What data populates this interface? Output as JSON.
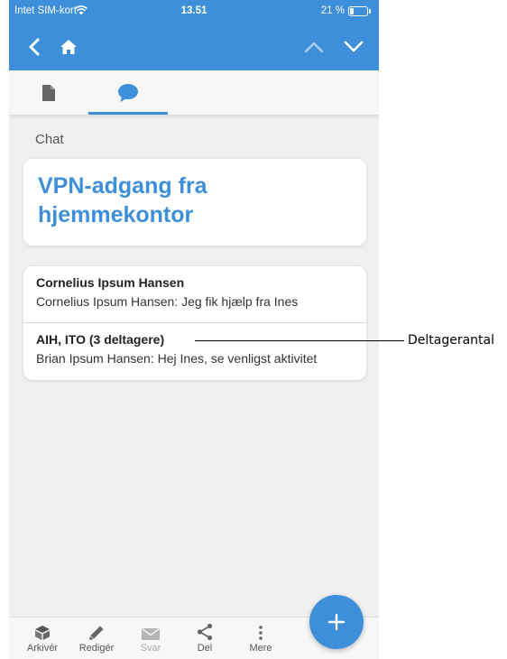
{
  "status_bar": {
    "carrier": "Intet SIM-kort",
    "time": "13.51",
    "battery": "21 %"
  },
  "nav": {
    "back_icon": "chevron-left-icon",
    "home_icon": "home-icon",
    "up_icon": "chevron-up-icon",
    "down_icon": "chevron-down-icon"
  },
  "tabs": [
    {
      "icon": "document-icon",
      "selected": false
    },
    {
      "icon": "chat-bubble-icon",
      "selected": true
    }
  ],
  "section_label": "Chat",
  "title": "VPN-adgang fra hjemmekontor",
  "chats": [
    {
      "name": "Cornelius Ipsum Hansen",
      "preview": "Cornelius Ipsum Hansen: Jeg fik hjælp fra Ines"
    },
    {
      "name": "AIH, ITO (3 deltagere)",
      "preview": "Brian Ipsum Hansen: Hej Ines, se venligst aktivitet"
    }
  ],
  "callout": "Deltagerantal",
  "toolbar": {
    "archive": "Arkivér",
    "edit": "Redigér",
    "reply": "Svar",
    "share": "Del",
    "more": "Mere"
  },
  "fab_icon": "plus-icon",
  "colors": {
    "accent": "#3e8fd9",
    "background": "#f0f0f0"
  }
}
